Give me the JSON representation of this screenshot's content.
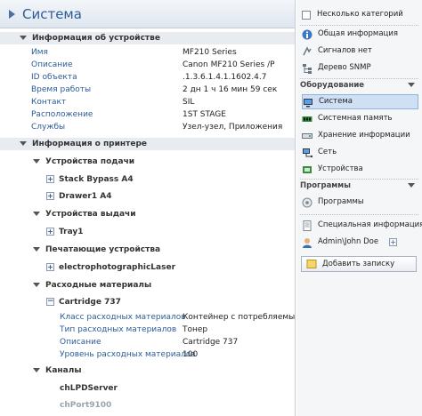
{
  "title": "Система",
  "device_info": {
    "header": "Информация об устройстве",
    "rows": [
      {
        "k": "Имя",
        "v": "MF210 Series"
      },
      {
        "k": "Описание",
        "v": "Canon MF210 Series /P"
      },
      {
        "k": "ID объекта",
        "v": ".1.3.6.1.4.1.1602.4.7"
      },
      {
        "k": "Время работы",
        "v": "2 дн 1 ч 16 мин 59 сек"
      },
      {
        "k": "Контакт",
        "v": "SIL"
      },
      {
        "k": "Расположение",
        "v": "1ST STAGE"
      },
      {
        "k": "Службы",
        "v": "Узел-узел, Приложения"
      }
    ]
  },
  "printer_info": {
    "header": "Информация о принтере",
    "input": {
      "label": "Устройства подачи",
      "items": [
        "Stack Bypass A4",
        "Drawer1 A4"
      ]
    },
    "output": {
      "label": "Устройства выдачи",
      "items": [
        "Tray1"
      ]
    },
    "marker": {
      "label": "Печатающие устройства",
      "items": [
        "electrophotographicLaser"
      ]
    },
    "supplies": {
      "label": "Расходные материалы",
      "item": "Cartridge 737",
      "rows": [
        {
          "k": "Класс расходных материалов",
          "v": "Контейнер с потребляемым..."
        },
        {
          "k": "Тип расходных материалов",
          "v": "Тонер"
        },
        {
          "k": "Описание",
          "v": "Cartridge 737"
        },
        {
          "k": "Уровень расходных материалов",
          "v": "100"
        }
      ]
    },
    "channels": {
      "label": "Каналы",
      "items": [
        "chLPDServer",
        "chPort9100"
      ]
    }
  },
  "sidebar": {
    "several_categories": "Несколько категорий",
    "top_items": [
      {
        "label": "Общая информация",
        "icon": "info-icon"
      },
      {
        "label": "Сигналов нет",
        "icon": "no-signal-icon"
      },
      {
        "label": "Дерево SNMP",
        "icon": "snmp-tree-icon"
      }
    ],
    "hardware_header": "Оборудование",
    "hardware_items": [
      {
        "label": "Система",
        "icon": "system-icon"
      },
      {
        "label": "Системная память",
        "icon": "memory-icon"
      },
      {
        "label": "Хранение информации",
        "icon": "storage-icon"
      },
      {
        "label": "Сеть",
        "icon": "network-icon"
      },
      {
        "label": "Устройства",
        "icon": "devices-icon"
      }
    ],
    "programs_header": "Программы",
    "programs_items": [
      {
        "label": "Программы",
        "icon": "programs-icon"
      }
    ],
    "special_info": "Специальная информация",
    "user": "Admin\\John Doe",
    "add_note": "Добавить записку"
  },
  "colors": {
    "accent": "#2c5c9a",
    "selection": "#cfe0f5"
  }
}
